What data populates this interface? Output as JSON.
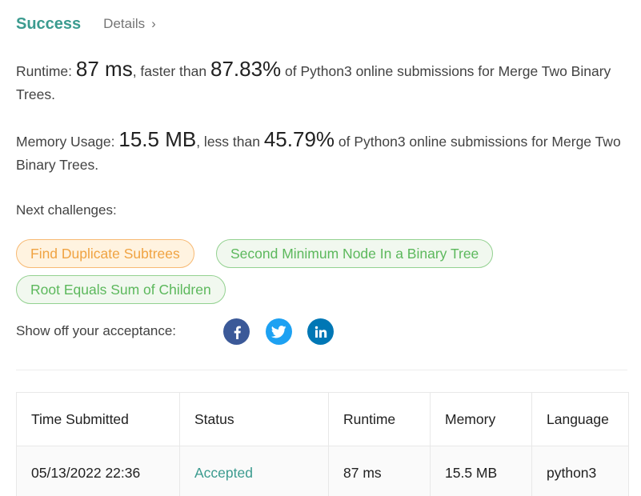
{
  "header": {
    "status": "Success",
    "details_label": "Details",
    "chevron": "›"
  },
  "runtime": {
    "label": "Runtime: ",
    "value": "87 ms",
    "mid": ", faster than ",
    "percent": "87.83%",
    "suffix": " of Python3 online submissions for Merge Two Binary Trees."
  },
  "memory": {
    "label": "Memory Usage: ",
    "value": "15.5 MB",
    "mid": ", less than ",
    "percent": "45.79%",
    "suffix": " of Python3 online submissions for Merge Two Binary Trees."
  },
  "next_challenges": {
    "label": "Next challenges:",
    "items": [
      {
        "label": "Find Duplicate Subtrees",
        "difficulty_color": "#f0a342"
      },
      {
        "label": "Second Minimum Node In a Binary Tree",
        "difficulty_color": "#5cb85c"
      },
      {
        "label": "Root Equals Sum of Children",
        "difficulty_color": "#5cb85c"
      }
    ]
  },
  "share": {
    "label": "Show off your acceptance:",
    "icons": [
      {
        "name": "facebook-icon",
        "color": "#3b5998"
      },
      {
        "name": "twitter-icon",
        "color": "#1da1f2"
      },
      {
        "name": "linkedin-icon",
        "color": "#0077b5"
      }
    ]
  },
  "table": {
    "headers": [
      "Time Submitted",
      "Status",
      "Runtime",
      "Memory",
      "Language"
    ],
    "rows": [
      {
        "time": "05/13/2022 22:36",
        "status": "Accepted",
        "runtime": "87 ms",
        "memory": "15.5 MB",
        "language": "python3"
      }
    ]
  },
  "colors": {
    "accent": "#3b9b8f",
    "text": "#424242"
  }
}
